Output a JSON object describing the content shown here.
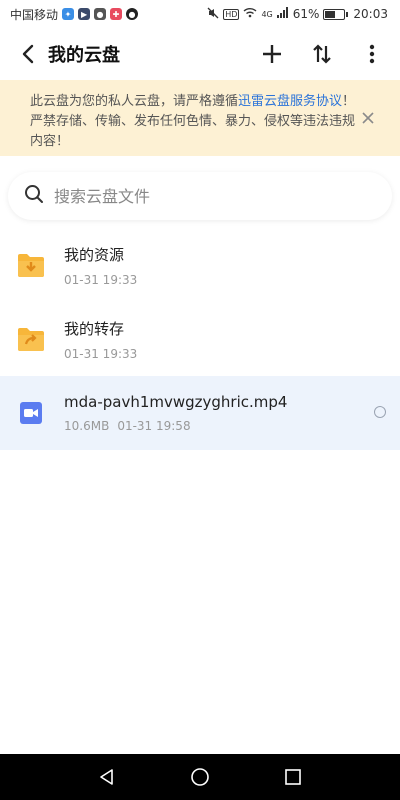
{
  "status_bar": {
    "carrier": "中国移动",
    "battery_percent_text": "61%",
    "battery_level": 0.61,
    "time": "20:03",
    "network": "4G",
    "hd": "HD"
  },
  "header": {
    "title": "我的云盘"
  },
  "notice": {
    "text_before": "此云盘为您的私人云盘，请严格遵循",
    "link_text": "迅雷云盘服务协议",
    "text_after": "！严禁存储、传输、发布任何色情、暴力、侵权等违法违规内容！"
  },
  "search": {
    "placeholder": "搜索云盘文件"
  },
  "files": [
    {
      "name": "我的资源",
      "date": "01-31 19:33",
      "size": "",
      "type": "folder-download"
    },
    {
      "name": "我的转存",
      "date": "01-31 19:33",
      "size": "",
      "type": "folder-transfer"
    },
    {
      "name": "mda-pavh1mvwgzyghric.mp4",
      "date": "01-31 19:58",
      "size": "10.6MB",
      "type": "video"
    }
  ],
  "colors": {
    "folder": "#f7b63a",
    "video": "#5b7cf0",
    "notice_bg": "#fdf1d4",
    "link": "#2a73d9",
    "selected_row": "#edf3fc"
  }
}
